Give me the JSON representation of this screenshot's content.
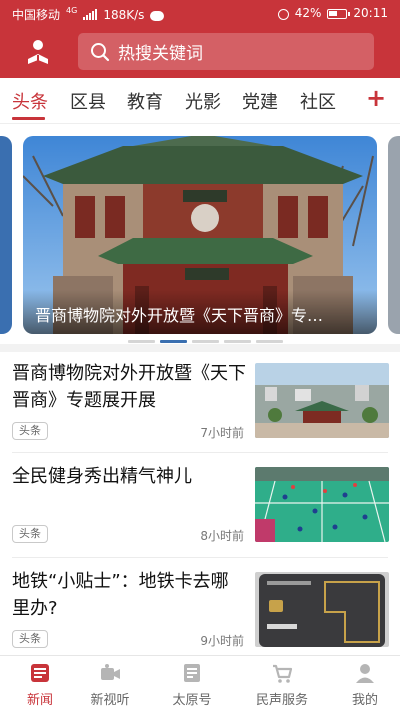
{
  "status_bar": {
    "carrier": "中国移动",
    "network": "4G",
    "speed": "188K/s",
    "battery": "42%",
    "time": "20:11"
  },
  "header": {
    "avatar_icon": "user-reading-icon",
    "search_placeholder": "热搜关键词"
  },
  "tabs": [
    "头条",
    "区县",
    "教育",
    "光影",
    "党建",
    "社区"
  ],
  "active_tab": "头条",
  "add_tab_label": "+",
  "banner": {
    "caption": "晋商博物院对外开放暨《天下晋商》专…",
    "slide_count": 5,
    "active_slide": 2
  },
  "news": [
    {
      "title": "晋商博物院对外开放暨《天下晋商》专题展开展",
      "tag": "头条",
      "time": "7小时前",
      "thumb": "museum-aerial"
    },
    {
      "title": "全民健身秀出精气神儿",
      "tag": "头条",
      "time": "8小时前",
      "thumb": "badminton-court"
    },
    {
      "title": "地铁“小贴士”：地铁卡去哪里办?",
      "tag": "头条",
      "time": "9小时前",
      "thumb": "metro-card"
    }
  ],
  "bottom_nav": [
    {
      "label": "新闻",
      "icon": "news-icon",
      "active": true
    },
    {
      "label": "新视听",
      "icon": "video-icon",
      "active": false
    },
    {
      "label": "太原号",
      "icon": "account-icon",
      "active": false
    },
    {
      "label": "民声服务",
      "icon": "cart-icon",
      "active": false
    },
    {
      "label": "我的",
      "icon": "profile-icon",
      "active": false
    }
  ],
  "colors": {
    "brand_red": "#c8343a",
    "dot_active": "#3a6fb0"
  }
}
